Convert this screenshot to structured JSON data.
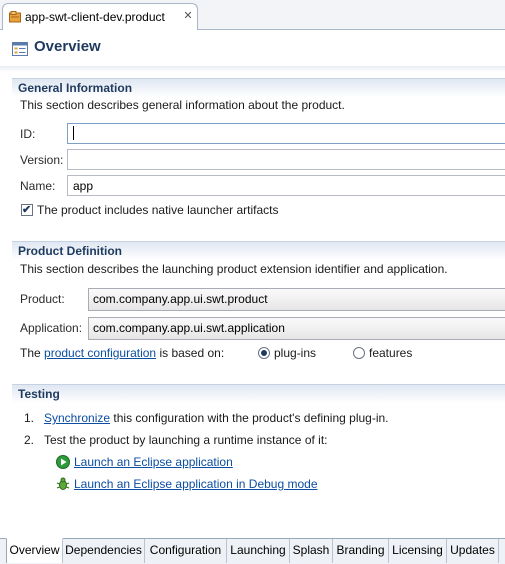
{
  "editor_tab": {
    "title": "app-swt-client-dev.product",
    "close_glyph": "✕"
  },
  "header": {
    "title": "Overview"
  },
  "general": {
    "title": "General Information",
    "description": "This section describes general information about the product.",
    "id_label": "ID:",
    "id_value": "",
    "version_label": "Version:",
    "version_value": "",
    "name_label": "Name:",
    "name_value": "app",
    "native_launcher_label": "The product includes native launcher artifacts",
    "native_launcher_checked": true
  },
  "product_definition": {
    "title": "Product Definition",
    "description": "This section describes the launching product extension identifier and application.",
    "product_label": "Product:",
    "product_value": "com.company.app.ui.swt.product",
    "application_label": "Application:",
    "application_value": "com.company.app.ui.swt.application",
    "config_prefix": "The",
    "config_link": "product configuration",
    "config_suffix": "is based on:",
    "option_plugins": "plug-ins",
    "option_features": "features",
    "selected_option": "plug-ins"
  },
  "testing": {
    "title": "Testing",
    "step1_num": "1.",
    "step1_link": "Synchronize",
    "step1_text": "this configuration with the product's defining plug-in.",
    "step2_num": "2.",
    "step2_text": "Test the product by launching a runtime instance of it:",
    "launch_link": "Launch an Eclipse application",
    "debug_link": "Launch an Eclipse application in Debug mode"
  },
  "page_tabs": [
    {
      "label": "Overview",
      "active": true
    },
    {
      "label": "Dependencies",
      "active": false
    },
    {
      "label": "Configuration",
      "active": false
    },
    {
      "label": "Launching",
      "active": false
    },
    {
      "label": "Splash",
      "active": false
    },
    {
      "label": "Branding",
      "active": false
    },
    {
      "label": "Licensing",
      "active": false
    },
    {
      "label": "Updates",
      "active": false
    }
  ],
  "colors": {
    "header_text": "#1f3a5f",
    "link": "#0b4ea2",
    "launch_green": "#2e9b3a"
  }
}
